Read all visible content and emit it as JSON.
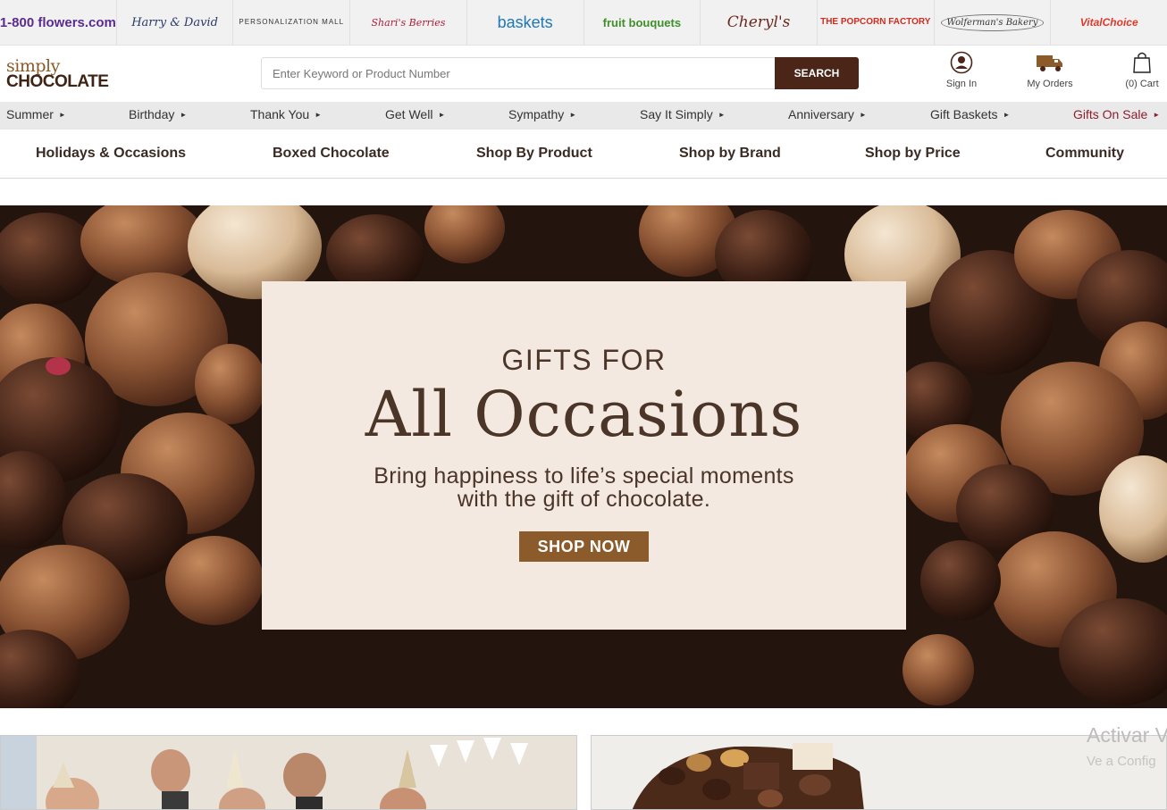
{
  "brands": [
    {
      "label": "1-800 flowers.com",
      "cls": "b-flowers"
    },
    {
      "label": "Harry & David",
      "cls": "b-hd"
    },
    {
      "label": "PERSONALIZATION MALL",
      "cls": "b-pm"
    },
    {
      "label": "Shari's Berries",
      "cls": "b-shari"
    },
    {
      "label": "baskets",
      "cls": "b-baskets"
    },
    {
      "label": "fruit bouquets",
      "cls": "b-fruit"
    },
    {
      "label": "Cheryl's",
      "cls": "b-cheryl"
    },
    {
      "label": "THE POPCORN FACTORY",
      "cls": "b-popcorn"
    },
    {
      "label": "Wolferman's Bakery",
      "cls": "b-wolf"
    },
    {
      "label": "VitalChoice",
      "cls": "b-vital"
    }
  ],
  "header": {
    "logo_line1": "simply",
    "logo_line2": "CHOCOLATE",
    "search_placeholder": "Enter Keyword or Product Number",
    "search_button": "SEARCH",
    "sign_in": "Sign In",
    "my_orders": "My Orders",
    "cart": "(0) Cart"
  },
  "occasions": [
    {
      "label": "Summer"
    },
    {
      "label": "Birthday"
    },
    {
      "label": "Thank You"
    },
    {
      "label": "Get Well"
    },
    {
      "label": "Sympathy"
    },
    {
      "label": "Say It Simply"
    },
    {
      "label": "Anniversary"
    },
    {
      "label": "Gift Baskets"
    },
    {
      "label": "Gifts On Sale"
    }
  ],
  "nav": [
    {
      "label": "Holidays & Occasions"
    },
    {
      "label": "Boxed Chocolate"
    },
    {
      "label": "Shop By Product"
    },
    {
      "label": "Shop by Brand"
    },
    {
      "label": "Shop by Price"
    },
    {
      "label": "Community"
    }
  ],
  "hero": {
    "kicker": "GIFTS FOR",
    "title": "All Occasions",
    "subtitle": "Bring happiness to life’s special moments with the gift of chocolate.",
    "cta": "SHOP NOW"
  },
  "watermark": {
    "line1": "Activar V",
    "line2": "Ve a Config"
  },
  "colors": {
    "brand_brown": "#4a2518",
    "cta_brown": "#8c5b2b",
    "card_bg": "#f4e9e0",
    "sale_red": "#8c1e30"
  }
}
